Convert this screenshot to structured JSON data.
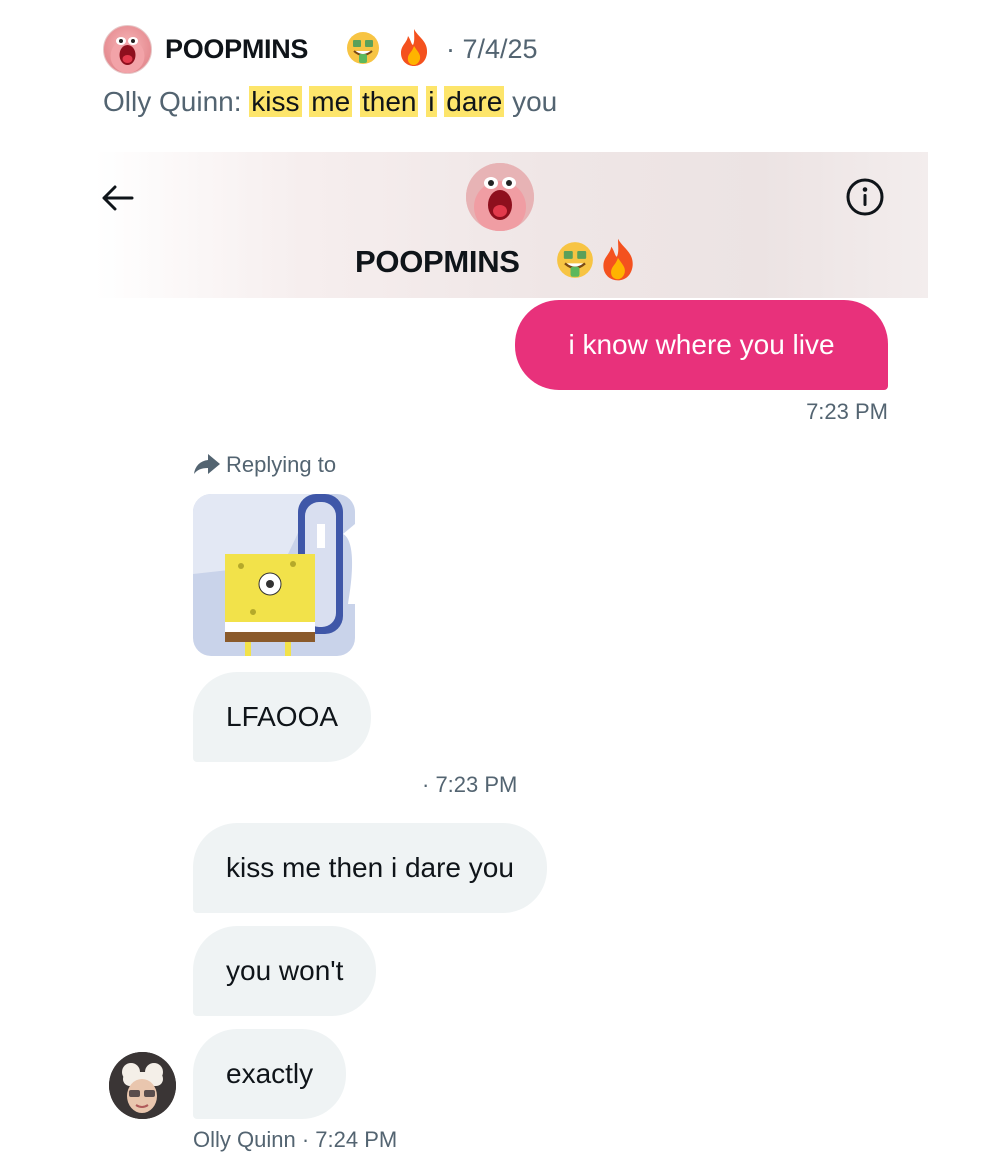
{
  "search_result": {
    "name": "POOPMINS",
    "emojis": [
      "money-mouth-face-icon",
      "fire-icon"
    ],
    "date": "· 7/4/25",
    "snippet": {
      "sender": "Olly Quinn:",
      "words": [
        {
          "text": "kiss",
          "highlight": true
        },
        {
          "text": "me",
          "highlight": true
        },
        {
          "text": "then",
          "highlight": true
        },
        {
          "text": "i",
          "highlight": true
        },
        {
          "text": "dare",
          "highlight": true
        },
        {
          "text": "you",
          "highlight": false
        }
      ]
    }
  },
  "conversation_header": {
    "name": "POOPMINS",
    "emojis": [
      "money-mouth-face-icon",
      "fire-icon"
    ]
  },
  "messages": {
    "outgoing_1": {
      "text": "i know where you live",
      "time": "7:23 PM"
    },
    "reply": {
      "label": "Replying to"
    },
    "incoming_1": {
      "text": "LFAOOA",
      "time": "· 7:23 PM"
    },
    "incoming_2": {
      "text": "kiss me then i dare you"
    },
    "incoming_3": {
      "text": "you won't"
    },
    "incoming_4": {
      "text": "exactly"
    },
    "footer": {
      "sender": "Olly Quinn",
      "time": "· 7:24 PM"
    }
  },
  "colors": {
    "outgoing_bubble": "#e8317b",
    "incoming_bubble": "#eff3f4",
    "highlight": "#fde56b",
    "secondary_text": "#536471"
  }
}
